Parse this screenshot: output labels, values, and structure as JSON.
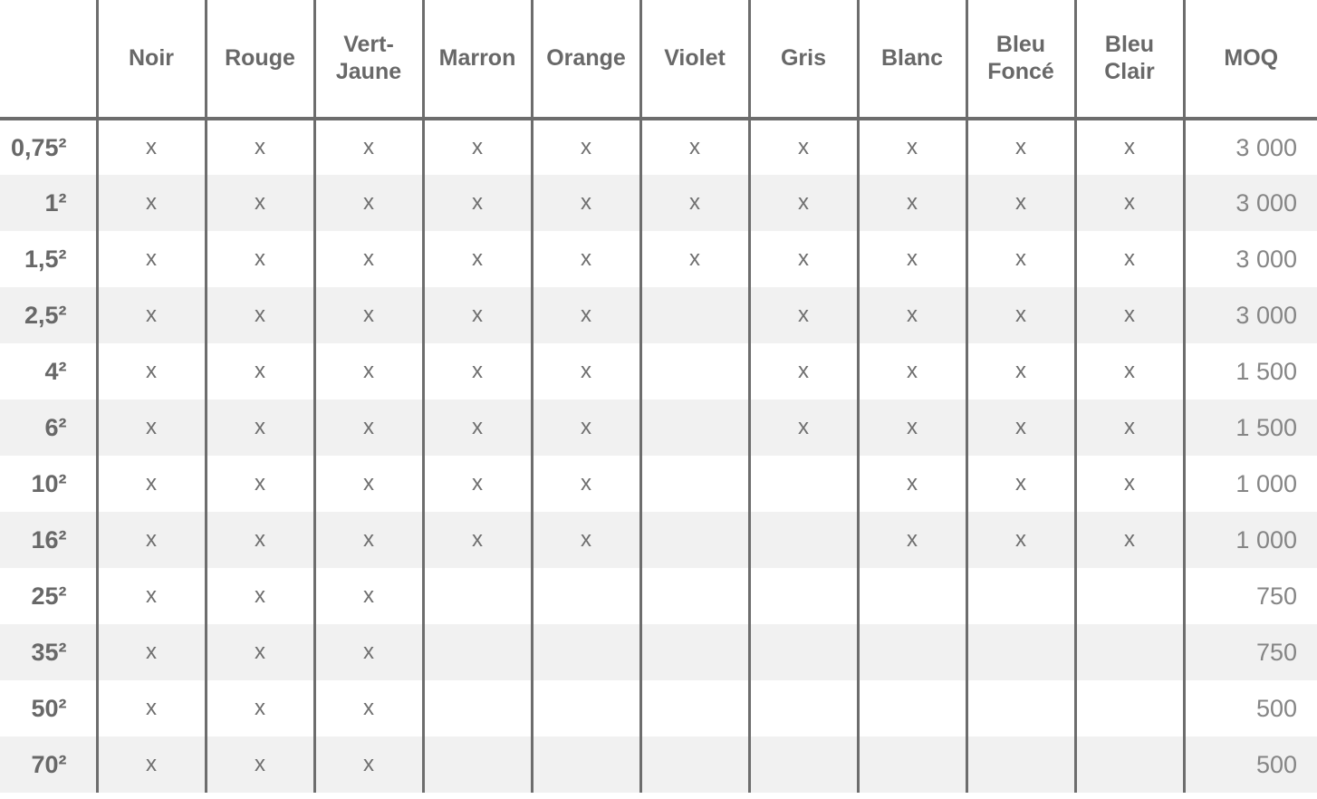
{
  "table": {
    "corner_label": "",
    "columns": [
      {
        "key": "noir",
        "label": "Noir"
      },
      {
        "key": "rouge",
        "label": "Rouge"
      },
      {
        "key": "vert_jaune",
        "label": "Vert-\nJaune"
      },
      {
        "key": "marron",
        "label": "Marron"
      },
      {
        "key": "orange",
        "label": "Orange"
      },
      {
        "key": "violet",
        "label": "Violet"
      },
      {
        "key": "gris",
        "label": "Gris"
      },
      {
        "key": "blanc",
        "label": "Blanc"
      },
      {
        "key": "bleu_fonce",
        "label": "Bleu\nFoncé"
      },
      {
        "key": "bleu_clair",
        "label": "Bleu\nClair"
      }
    ],
    "moq_column_label": "MOQ",
    "mark_symbol": "x",
    "rows": [
      {
        "label": "0,75²",
        "marks": [
          "x",
          "x",
          "x",
          "x",
          "x",
          "x",
          "x",
          "x",
          "x",
          "x"
        ],
        "moq": "3 000"
      },
      {
        "label": "1²",
        "marks": [
          "x",
          "x",
          "x",
          "x",
          "x",
          "x",
          "x",
          "x",
          "x",
          "x"
        ],
        "moq": "3 000"
      },
      {
        "label": "1,5²",
        "marks": [
          "x",
          "x",
          "x",
          "x",
          "x",
          "x",
          "x",
          "x",
          "x",
          "x"
        ],
        "moq": "3 000"
      },
      {
        "label": "2,5²",
        "marks": [
          "x",
          "x",
          "x",
          "x",
          "x",
          "",
          "x",
          "x",
          "x",
          "x"
        ],
        "moq": "3 000"
      },
      {
        "label": "4²",
        "marks": [
          "x",
          "x",
          "x",
          "x",
          "x",
          "",
          "x",
          "x",
          "x",
          "x"
        ],
        "moq": "1 500"
      },
      {
        "label": "6²",
        "marks": [
          "x",
          "x",
          "x",
          "x",
          "x",
          "",
          "x",
          "x",
          "x",
          "x"
        ],
        "moq": "1 500"
      },
      {
        "label": "10²",
        "marks": [
          "x",
          "x",
          "x",
          "x",
          "x",
          "",
          "",
          "x",
          "x",
          "x"
        ],
        "moq": "1 000"
      },
      {
        "label": "16²",
        "marks": [
          "x",
          "x",
          "x",
          "x",
          "x",
          "",
          "",
          "x",
          "x",
          "x"
        ],
        "moq": "1 000"
      },
      {
        "label": "25²",
        "marks": [
          "x",
          "x",
          "x",
          "",
          "",
          "",
          "",
          "",
          "",
          ""
        ],
        "moq": "750"
      },
      {
        "label": "35²",
        "marks": [
          "x",
          "x",
          "x",
          "",
          "",
          "",
          "",
          "",
          "",
          ""
        ],
        "moq": "750"
      },
      {
        "label": "50²",
        "marks": [
          "x",
          "x",
          "x",
          "",
          "",
          "",
          "",
          "",
          "",
          ""
        ],
        "moq": "500"
      },
      {
        "label": "70²",
        "marks": [
          "x",
          "x",
          "x",
          "",
          "",
          "",
          "",
          "",
          "",
          ""
        ],
        "moq": "500"
      }
    ]
  },
  "colors": {
    "grid_line": "#6d6d6d",
    "header_text": "#686868",
    "body_text": "#7a7a7a",
    "stripe_background": "#f1f1f1",
    "page_background": "#ffffff"
  }
}
